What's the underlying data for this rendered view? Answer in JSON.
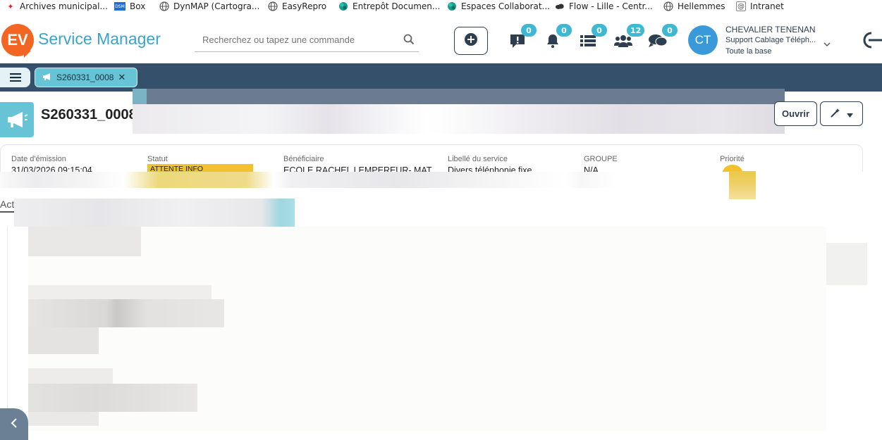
{
  "bookmarks": [
    {
      "label": "Archives municipal...",
      "icon": "red-leaf-icon",
      "color": "#d7282f"
    },
    {
      "label": "Box",
      "icon": "dsm-icon",
      "color": "#1f6fd1"
    },
    {
      "label": "DynMAP (Cartogra...",
      "icon": "globe-icon",
      "color": "#555555"
    },
    {
      "label": "EasyRepro",
      "icon": "globe-icon",
      "color": "#555555"
    },
    {
      "label": "Entrepôt Documen...",
      "icon": "sharepoint-icon",
      "color": "#1a9c8c"
    },
    {
      "label": "Espaces Collaborat...",
      "icon": "sharepoint-icon",
      "color": "#1a9c8c"
    },
    {
      "label": "Flow - Lille - Centr...",
      "icon": "cloud-icon",
      "color": "#333333"
    },
    {
      "label": "Hellemmes",
      "icon": "globe-icon",
      "color": "#555555"
    },
    {
      "label": "Intranet",
      "icon": "at-icon",
      "color": "#555555"
    }
  ],
  "header": {
    "logo_text": "EV",
    "app_name": "Service Manager",
    "search_placeholder": "Recherchez ou tapez une commande",
    "badges": {
      "alerts": "0",
      "notifications": "0",
      "tasks": "0",
      "teams": "12",
      "messages": "0"
    },
    "user": {
      "initials": "CT",
      "name": "CHEVALIER TENENAN",
      "role": "Support Cablage Téléph...",
      "scope": "Toute la base"
    }
  },
  "tabs": {
    "active_label": "S260331_0008"
  },
  "record": {
    "title": "S260331_0008",
    "open_button": "Ouvrir"
  },
  "summary": {
    "fields": [
      {
        "label": "Date d'émission",
        "value": "31/03/2026 09:15:04"
      },
      {
        "label": "Statut",
        "value": "ATTENTE INFO PRESTATAIRE"
      },
      {
        "label": "Bénéficiaire",
        "value": "ECOLE RACHEL LEMPEREUR- MAT"
      },
      {
        "label": "Libellé du service",
        "value": "Divers téléphonie fixe"
      },
      {
        "label": "GROUPE",
        "value": "N/A"
      },
      {
        "label": "Priorité",
        "value": ""
      }
    ]
  },
  "activity": {
    "tab_label": "Activités"
  },
  "colors": {
    "brand_orange": "#f26522",
    "brand_blue": "#3aa3c9",
    "navy": "#34506b",
    "teal": "#67c4d6",
    "badge": "#3fb9d3",
    "status_yellow": "#f2c12e"
  }
}
